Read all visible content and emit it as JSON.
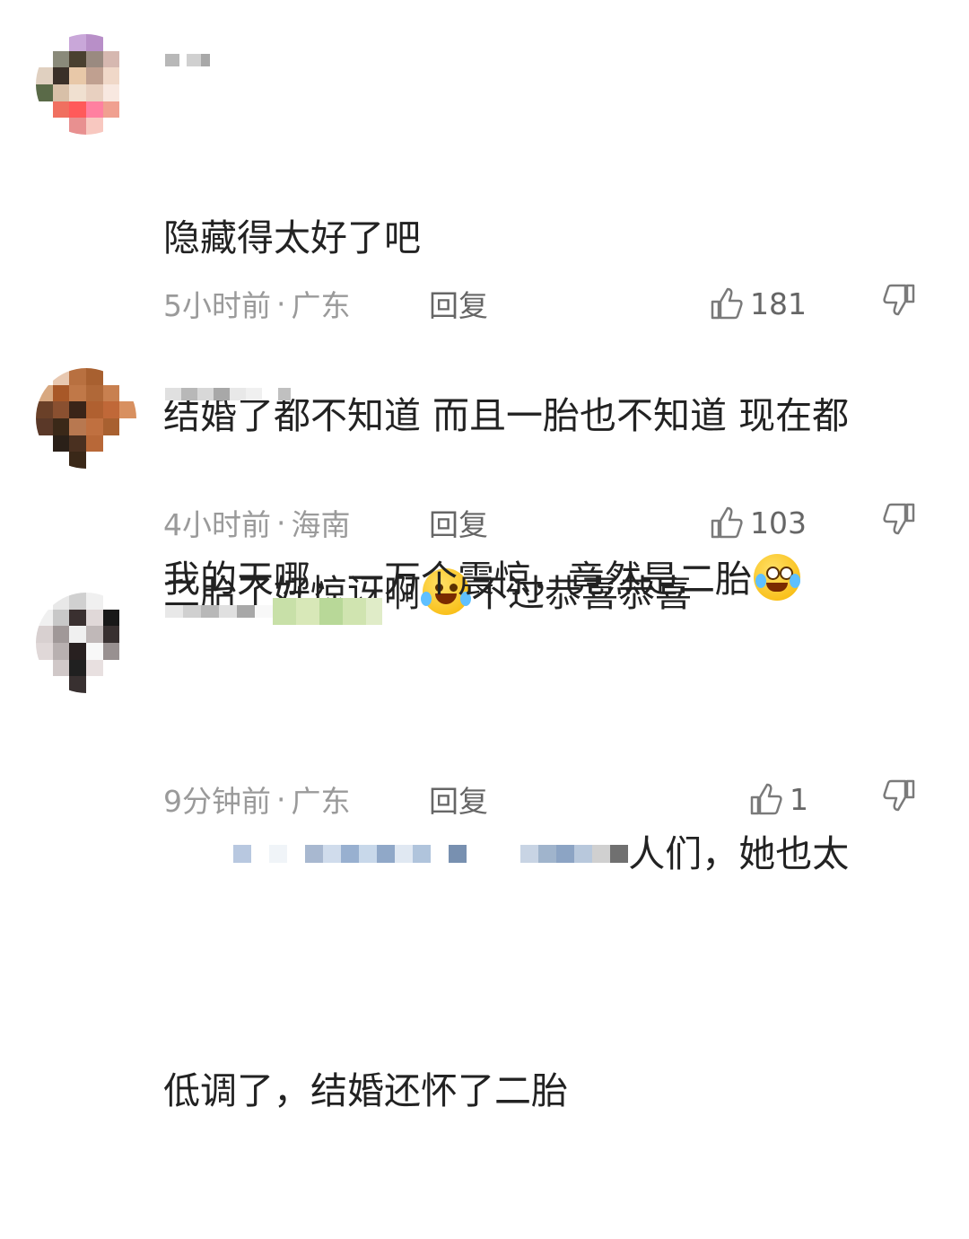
{
  "comments": [
    {
      "lines": [
        "隐藏得太好了吧",
        "结婚了都不知道 而且一胎也不知道 现在都",
        "二胎了好惊讶啊"
      ],
      "after_emoji": "不过恭喜恭喜",
      "emoji": "laughing-tears-icon",
      "time": "5小时前",
      "region": "广东",
      "reply_label": "回复",
      "likes": "181"
    },
    {
      "lines": [
        "我的天哪，一万个震惊，竟然是二胎"
      ],
      "emoji": "crying-face-icon",
      "time": "4小时前",
      "region": "海南",
      "reply_label": "回复",
      "likes": "103"
    },
    {
      "line1_visible": "人们，她也太",
      "line2": "低调了，结婚还怀了二胎",
      "time": "9分钟前",
      "region": "广东",
      "reply_label": "回复",
      "likes": "1"
    }
  ],
  "colors": {
    "text": "#222222",
    "meta": "#9a9a9a",
    "emoji": "#f7b500"
  }
}
